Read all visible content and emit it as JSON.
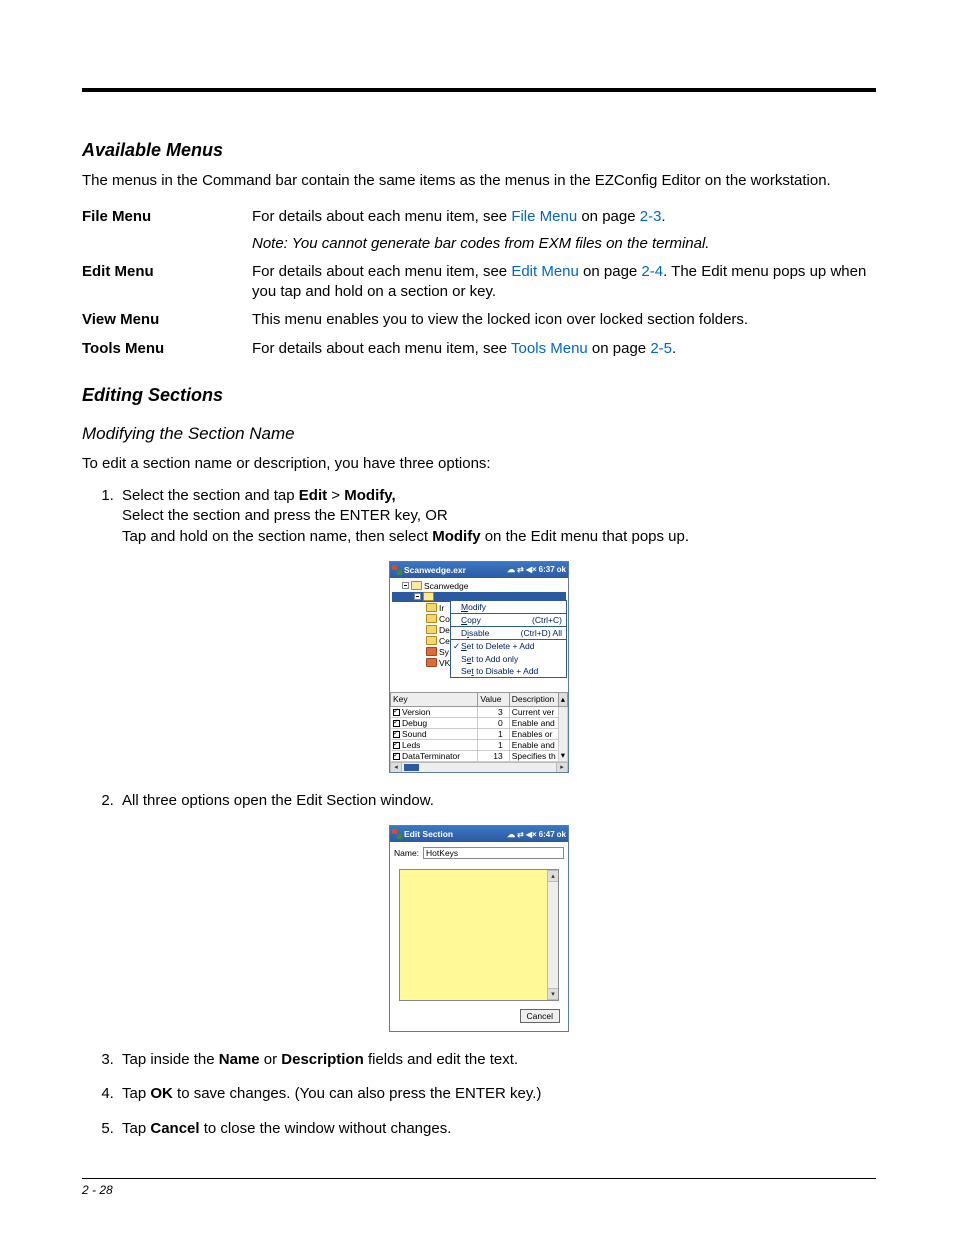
{
  "headings": {
    "available_menus": "Available Menus",
    "editing_sections": "Editing Sections",
    "modifying_name": "Modifying the Section Name"
  },
  "intro_para": "The menus in the Command bar contain the same items as the menus in the EZConfig Editor on the workstation.",
  "menus": {
    "file": {
      "label": "File Menu",
      "desc_pre": "For details about each menu item, see ",
      "link": "File Menu",
      "desc_mid": " on page ",
      "page_link": "2-3",
      "desc_suf": ".",
      "note": "Note:   You cannot generate bar codes from EXM files on the terminal."
    },
    "edit": {
      "label": "Edit Menu",
      "desc_pre": "For details about each menu item, see ",
      "link": "Edit Menu",
      "desc_mid": " on page ",
      "page_link": "2-4",
      "desc_suf": ". The Edit menu pops up when you tap and hold on a section or key."
    },
    "view": {
      "label": "View Menu",
      "desc": "This menu enables you to view the locked icon over locked section folders."
    },
    "tools": {
      "label": "Tools Menu",
      "desc_pre": "For details about each menu item, see ",
      "link": "Tools Menu",
      "desc_mid": " on page ",
      "page_link": "2-5",
      "desc_suf": "."
    }
  },
  "modifying_intro": "To edit a section name or description, you have three options:",
  "step1": {
    "l1a": "Select the section and tap ",
    "l1b_bold": "Edit",
    "l1c": " > ",
    "l1d_bold": "Modify,",
    "l2": "Select the section and press the ENTER key, OR",
    "l3a": "Tap and hold on the section name, then select ",
    "l3b_bold": "Modify",
    "l3c": " on the Edit menu that pops up."
  },
  "step2": "All three options open the Edit Section window.",
  "step3": {
    "a": "Tap inside the ",
    "b_bold": "Name",
    "c": " or ",
    "d_bold": "Description",
    "e": " fields and edit the text."
  },
  "step4": {
    "a": "Tap ",
    "b_bold": "OK",
    "c": " to save changes. (You can also press the ENTER key.)"
  },
  "step5": {
    "a": "Tap ",
    "b_bold": "Cancel",
    "c": " to close the window without changes."
  },
  "screenshot1": {
    "title": "Scanwedge.exr",
    "time": "6:37",
    "ok": "ok",
    "tree_root": "Scanwedge",
    "tree_sel": "",
    "tree_items": [
      "Ir",
      "Co",
      "De",
      "Ce",
      "Sy",
      "VK"
    ],
    "context_menu": [
      {
        "label": "Modify",
        "shortcut": ""
      },
      {
        "label": "Copy",
        "shortcut": "(Ctrl+C)"
      },
      {
        "label": "Disable",
        "shortcut": "(Ctrl+D) All"
      },
      {
        "label": "Set to Delete + Add",
        "shortcut": "",
        "checked": true
      },
      {
        "label": "Set to Add only",
        "shortcut": ""
      },
      {
        "label": "Set to Disable + Add",
        "shortcut": ""
      }
    ],
    "table_headers": [
      "Key",
      "Value",
      "Description"
    ],
    "table_rows": [
      {
        "key": "Version",
        "value": "3",
        "desc": "Current ver"
      },
      {
        "key": "Debug",
        "value": "0",
        "desc": "Enable and"
      },
      {
        "key": "Sound",
        "value": "1",
        "desc": "Enables or"
      },
      {
        "key": "Leds",
        "value": "1",
        "desc": "Enable and"
      },
      {
        "key": "DataTerminator",
        "value": "13",
        "desc": "Specifies th"
      }
    ]
  },
  "screenshot2": {
    "title": "Edit Section",
    "time": "6:47",
    "ok": "ok",
    "name_label": "Name:",
    "name_value": "HotKeys",
    "cancel": "Cancel"
  },
  "footer": "2 - 28"
}
